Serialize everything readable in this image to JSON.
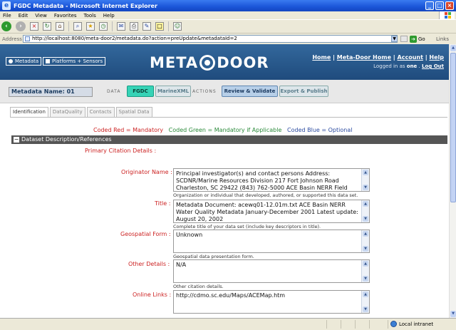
{
  "window": {
    "title": "FGDC Metadata - Microsoft Internet Explorer",
    "browser_icon": "ie-icon"
  },
  "menu": [
    "File",
    "Edit",
    "View",
    "Favorites",
    "Tools",
    "Help"
  ],
  "address": {
    "label": "Address",
    "url": "http://localhost:8080/meta-door2/metadata.do?action=preUpdate&metadataId=2",
    "go_label": "Go",
    "links_label": "Links"
  },
  "site": {
    "nav_metadata": "Metadata",
    "nav_platforms": "Platforms + Sensors",
    "logo_left": "META",
    "logo_right": "DOOR",
    "links": [
      "Home",
      "Meta-Door Home",
      "Account",
      "Help"
    ],
    "logged_in_prefix": "Logged in as",
    "user": "one",
    "logout": "Log Out"
  },
  "meta_bar": {
    "name_label": "Metadata Name: 01",
    "data_label": "DATA",
    "format_fgdc": "FGDC",
    "format_marine": "MarineXML",
    "actions_label": "ACTIONS",
    "review": "Review & Validate",
    "export": "Export & Publish"
  },
  "tabs": [
    "Identification",
    "DataQuality",
    "Contacts",
    "Spatial Data"
  ],
  "legend": {
    "red": "Coded Red = Mandatory",
    "green": "Coded Green = Mandatory if Applicable",
    "blue": "Coded Blue = Optional"
  },
  "section": {
    "title": "Dataset Description/References",
    "primary_citation": "Primary Citation Details :"
  },
  "fields": {
    "originator": {
      "label": "Originator Name :",
      "value": "Principal investigator(s) and contact persons Address: SCDNR/Marine Resources Division 217 Fort Johnson Road Charleston, SC 29422 (843) 762-5000 ACE Basin NERR Field",
      "hint": "Organization or individual that developed, authored, or supported this data set."
    },
    "title": {
      "label": "Title :",
      "value": "Metadata Document: acewq01-12.01m.txt ACE Basin NERR Water Quality Metadata January-December 2001 Latest update: August 20, 2002",
      "hint": "Complete title of your data set (include key descriptors in title)."
    },
    "geospatial": {
      "label": "Geospatial Form :",
      "value": "Unknown",
      "hint": "Geospatial data presentation form."
    },
    "other": {
      "label": "Other Details :",
      "value": "N/A",
      "hint": "Other citation details."
    },
    "online": {
      "label": "Online Links :",
      "value": "http://cdmo.sc.edu/Maps/ACEMap.htm"
    }
  },
  "status": {
    "zone": "Local intranet"
  },
  "colors": {
    "mandatory": "#cc2222",
    "conditional": "#2a8a3a",
    "optional": "#2a4aa0",
    "header_blue": "#2a5a8d",
    "fgdc_green": "#36d3b6"
  }
}
